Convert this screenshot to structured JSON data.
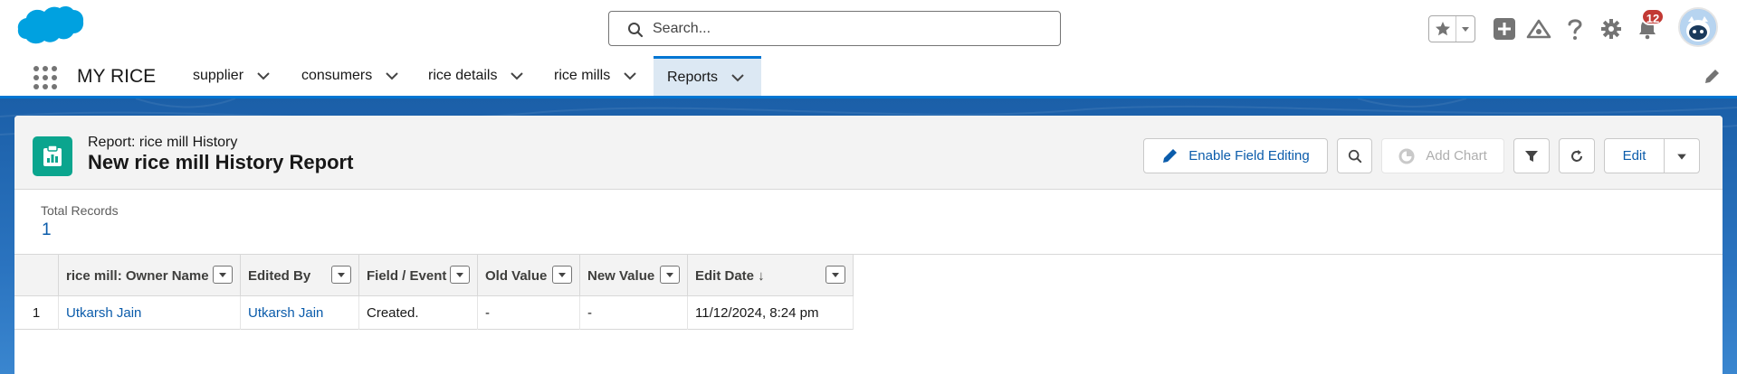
{
  "header": {
    "search_placeholder": "Search...",
    "notification_count": "12"
  },
  "nav": {
    "app_name": "MY RICE",
    "items": [
      {
        "label": "supplier"
      },
      {
        "label": "consumers"
      },
      {
        "label": "rice details"
      },
      {
        "label": "rice mills"
      },
      {
        "label": "Reports",
        "active": true
      }
    ]
  },
  "report": {
    "eyebrow": "Report: rice mill History",
    "title": "New rice mill History Report",
    "buttons": {
      "enable_field_editing": "Enable Field Editing",
      "add_chart": "Add Chart",
      "edit": "Edit"
    },
    "total_records_label": "Total Records",
    "total_records_value": "1",
    "columns": [
      {
        "label": "rice mill: Owner Name"
      },
      {
        "label": "Edited By"
      },
      {
        "label": "Field / Event"
      },
      {
        "label": "Old Value"
      },
      {
        "label": "New Value"
      },
      {
        "label": "Edit Date ↓"
      }
    ],
    "rows": [
      {
        "row_number": "1",
        "owner_name": "Utkarsh Jain",
        "edited_by": "Utkarsh Jain",
        "field_event": "Created.",
        "old_value": "-",
        "new_value": "-",
        "edit_date": "11/12/2024, 8:24 pm"
      }
    ]
  },
  "colors": {
    "brand_blue": "#0176d3",
    "link_blue": "#0b5cab",
    "report_icon_green": "#0ba58e",
    "badge_red": "#c23934"
  }
}
